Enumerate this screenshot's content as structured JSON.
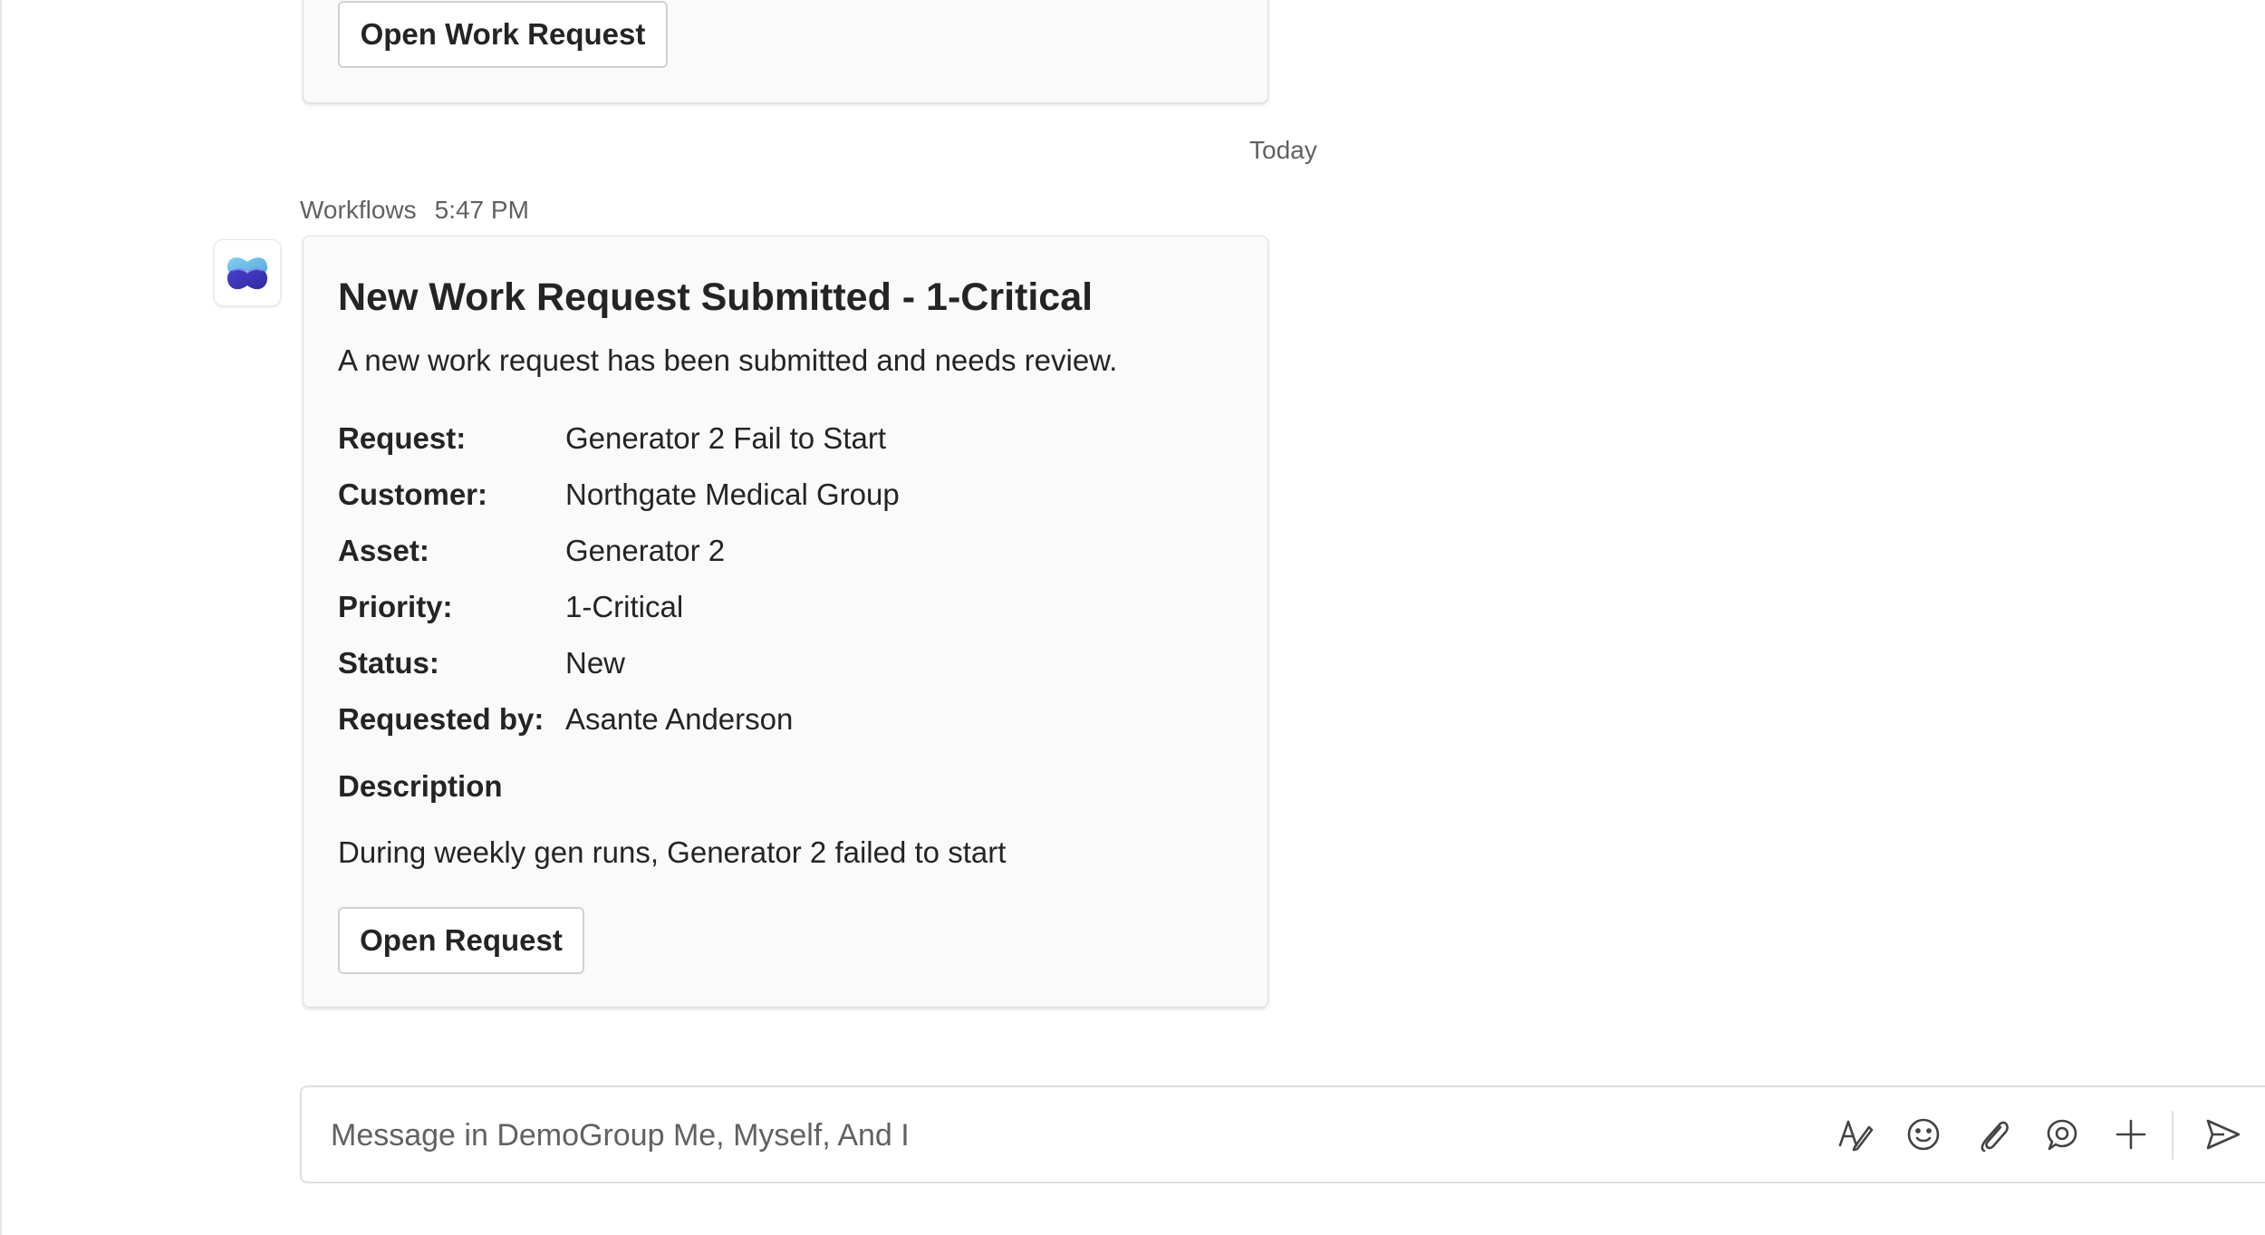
{
  "previous_card": {
    "button_label": "Open Work Request"
  },
  "date_divider": "Today",
  "message": {
    "sender": "Workflows",
    "time": "5:47 PM",
    "avatar_icon": "workflows-logo-icon",
    "card": {
      "title": "New Work Request Submitted - 1-Critical",
      "subtitle": "A new work request has been submitted and needs review.",
      "facts": [
        {
          "label": "Request:",
          "value": "Generator 2 Fail to Start"
        },
        {
          "label": "Customer:",
          "value": "Northgate Medical Group"
        },
        {
          "label": "Asset:",
          "value": "Generator 2"
        },
        {
          "label": "Priority:",
          "value": "1-Critical"
        },
        {
          "label": "Status:",
          "value": "New"
        },
        {
          "label": "Requested by:",
          "value": "Asante Anderson"
        }
      ],
      "description_heading": "Description",
      "description": "During weekly gen runs, Generator 2 failed to start",
      "button_label": "Open Request"
    }
  },
  "compose": {
    "placeholder": "Message in DemoGroup Me, Myself, And I",
    "tools": [
      "format-icon",
      "emoji-icon",
      "attach-icon",
      "loop-icon",
      "plus-icon",
      "send-icon"
    ]
  },
  "colors": {
    "brand_purple": "#5b5fc7",
    "card_bg": "#fafafa",
    "muted_text": "#616161"
  }
}
